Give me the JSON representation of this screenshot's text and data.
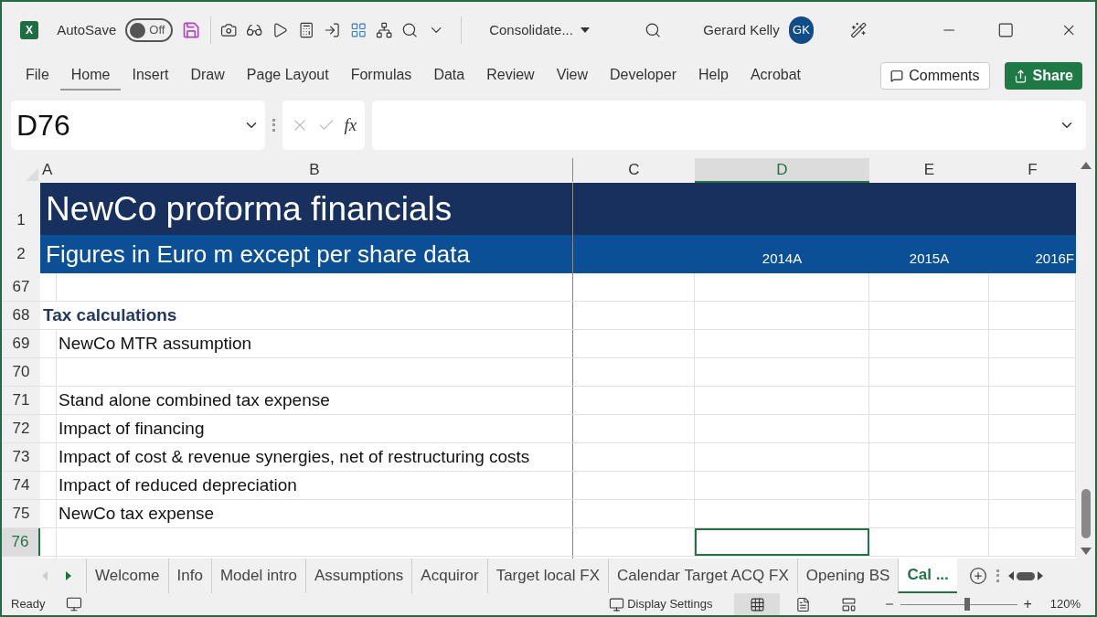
{
  "title_bar": {
    "app_logo": "X",
    "autosave_label": "AutoSave",
    "autosave_toggle": {
      "label": "Off",
      "on": false
    },
    "file_name": "Consolidate...",
    "user_name": "Gerard Kelly",
    "user_initials": "GK"
  },
  "ribbon_tabs": [
    {
      "label": "File",
      "selected": false
    },
    {
      "label": "Home",
      "selected": true
    },
    {
      "label": "Insert",
      "selected": false
    },
    {
      "label": "Draw",
      "selected": false
    },
    {
      "label": "Page Layout",
      "selected": false
    },
    {
      "label": "Formulas",
      "selected": false
    },
    {
      "label": "Data",
      "selected": false
    },
    {
      "label": "Review",
      "selected": false
    },
    {
      "label": "View",
      "selected": false
    },
    {
      "label": "Developer",
      "selected": false
    },
    {
      "label": "Help",
      "selected": false
    },
    {
      "label": "Acrobat",
      "selected": false
    }
  ],
  "comments_button": "Comments",
  "share_button": "Share",
  "formula_bar": {
    "name_box": "D76",
    "function_button": "fx"
  },
  "sheet": {
    "columns": [
      {
        "label": "A",
        "selected": false
      },
      {
        "label": "B",
        "selected": false
      },
      {
        "label": "C",
        "selected": false
      },
      {
        "label": "D",
        "selected": true
      },
      {
        "label": "E",
        "selected": false
      },
      {
        "label": "F",
        "selected": false
      }
    ],
    "title_row": {
      "number": "1",
      "text": "NewCo proforma financials"
    },
    "subtitle_row": {
      "number": "2",
      "text": "Figures in Euro m except per share data",
      "years": [
        "2014A",
        "2015A",
        "2016F"
      ]
    },
    "rows": [
      {
        "number": "67",
        "kind": "blank",
        "selected": false
      },
      {
        "number": "68",
        "kind": "heading",
        "text": "Tax calculations",
        "selected": false
      },
      {
        "number": "69",
        "kind": "item",
        "text": "NewCo MTR assumption",
        "selected": false
      },
      {
        "number": "70",
        "kind": "blank",
        "selected": false
      },
      {
        "number": "71",
        "kind": "item",
        "text": "Stand alone combined tax expense",
        "selected": false
      },
      {
        "number": "72",
        "kind": "item",
        "text": "Impact of financing",
        "selected": false
      },
      {
        "number": "73",
        "kind": "item",
        "text": "Impact of cost & revenue synergies, net of restructuring costs",
        "selected": false
      },
      {
        "number": "74",
        "kind": "item",
        "text": "Impact of reduced depreciation",
        "selected": false
      },
      {
        "number": "75",
        "kind": "item",
        "text": "NewCo tax expense",
        "selected": false
      },
      {
        "number": "76",
        "kind": "blank",
        "selected": true
      }
    ]
  },
  "sheet_tabs": [
    {
      "label": "Welcome",
      "selected": false
    },
    {
      "label": "Info",
      "selected": false
    },
    {
      "label": "Model intro",
      "selected": false
    },
    {
      "label": "Assumptions",
      "selected": false
    },
    {
      "label": "Acquiror",
      "selected": false
    },
    {
      "label": "Target local FX",
      "selected": false
    },
    {
      "label": "Calendar Target ACQ FX",
      "selected": false
    },
    {
      "label": "Opening BS",
      "selected": false
    },
    {
      "label": "Cal ...",
      "selected": true
    }
  ],
  "status_bar": {
    "status": "Ready",
    "display_settings": "Display Settings",
    "views": [
      {
        "kind": "normal",
        "selected": true
      },
      {
        "kind": "page-layout",
        "selected": false
      },
      {
        "kind": "page-break",
        "selected": false
      }
    ],
    "zoom": {
      "level": 0.57,
      "reading": "120%",
      "zoom_in": "+"
    }
  }
}
